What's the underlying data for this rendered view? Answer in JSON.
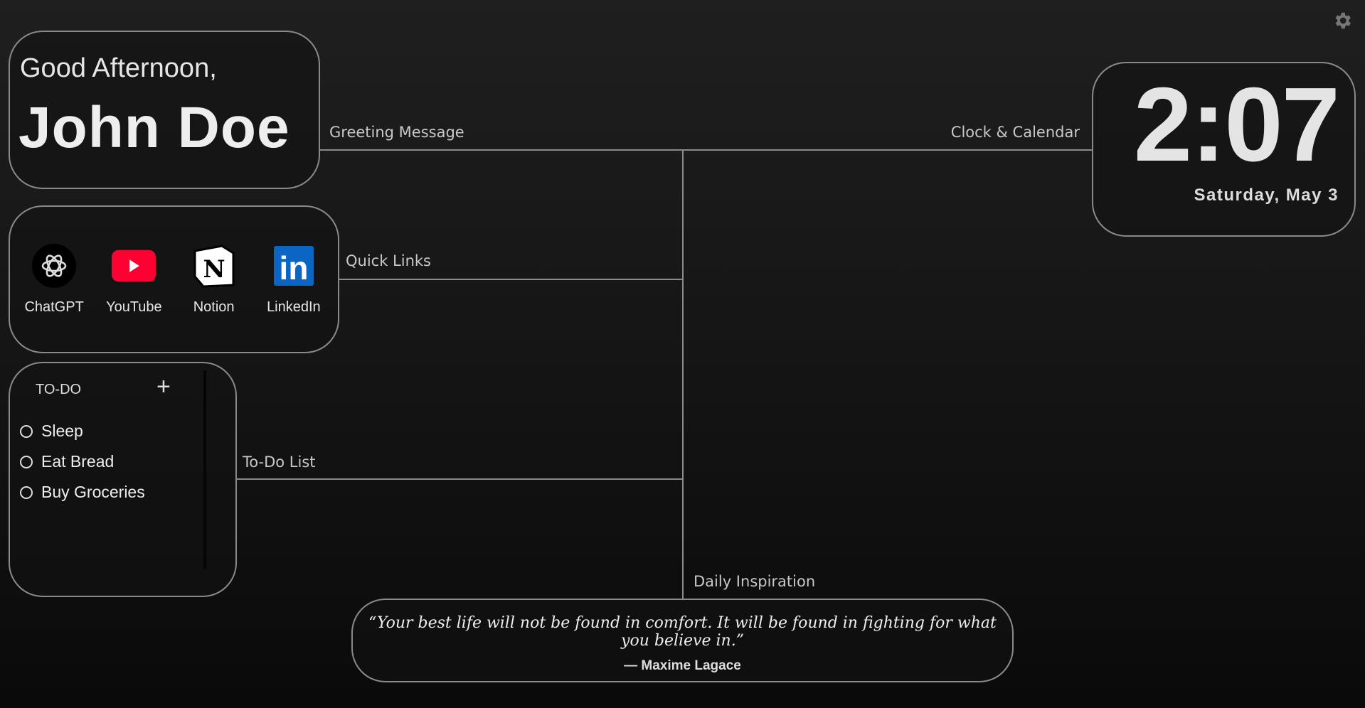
{
  "greeting": {
    "salutation": "Good Afternoon,",
    "name": "John Doe",
    "label": "Greeting Message"
  },
  "quick_links": {
    "label": "Quick Links",
    "items": [
      {
        "label": "ChatGPT",
        "icon": "chatgpt-icon"
      },
      {
        "label": "YouTube",
        "icon": "youtube-icon",
        "color": "#ff0033"
      },
      {
        "label": "Notion",
        "icon": "notion-icon"
      },
      {
        "label": "LinkedIn",
        "icon": "linkedin-icon",
        "color": "#0a66c2"
      }
    ]
  },
  "todo": {
    "label": "To-Do List",
    "header": "TO-DO",
    "add": "+",
    "items": [
      "Sleep",
      "Eat Bread",
      "Buy Groceries"
    ]
  },
  "clock": {
    "label": "Clock & Calendar",
    "time": "2:07",
    "date": "Saturday, May 3"
  },
  "inspiration": {
    "label": "Daily Inspiration",
    "quote": "“Your best life will not be found in comfort. It will be found in fighting for what you believe in.”",
    "author": "— Maxime Lagace"
  }
}
